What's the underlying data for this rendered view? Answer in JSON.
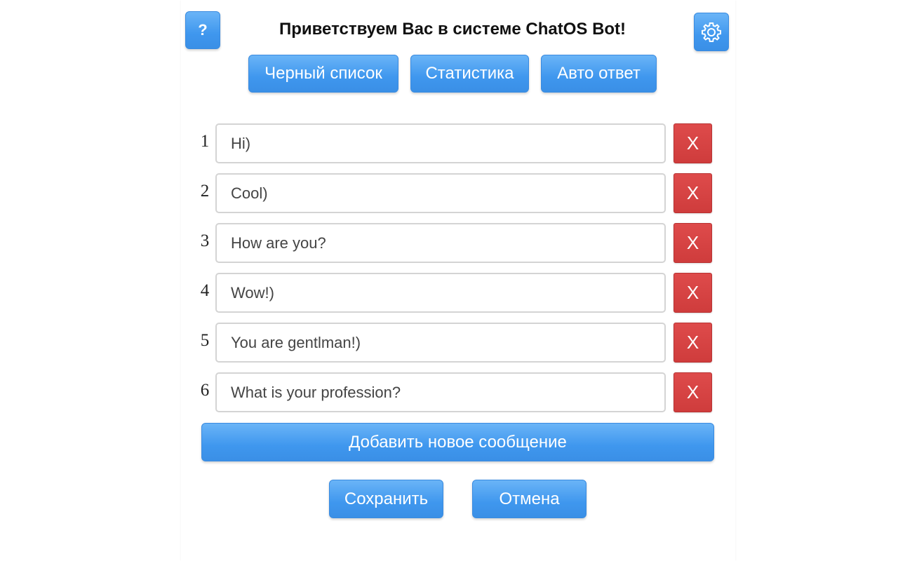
{
  "header": {
    "help_label": "?",
    "title": "Приветствуем Вас в системе ChatOS Bot!",
    "settings_icon": "gear-icon"
  },
  "nav": [
    {
      "label": "Черный список"
    },
    {
      "label": "Статистика"
    },
    {
      "label": "Авто ответ"
    }
  ],
  "messages": [
    {
      "number": "1",
      "value": "Hi)",
      "delete_label": "X"
    },
    {
      "number": "2",
      "value": "Cool)",
      "delete_label": "X"
    },
    {
      "number": "3",
      "value": "How are you?",
      "delete_label": "X"
    },
    {
      "number": "4",
      "value": "Wow!)",
      "delete_label": "X"
    },
    {
      "number": "5",
      "value": "You are gentlman!)",
      "delete_label": "X"
    },
    {
      "number": "6",
      "value": "What is your profession?",
      "delete_label": "X"
    }
  ],
  "actions": {
    "add_label": "Добавить новое сообщение",
    "save_label": "Сохранить",
    "cancel_label": "Отмена"
  },
  "colors": {
    "primary": "#3f97ee",
    "danger": "#cf3c3c"
  }
}
